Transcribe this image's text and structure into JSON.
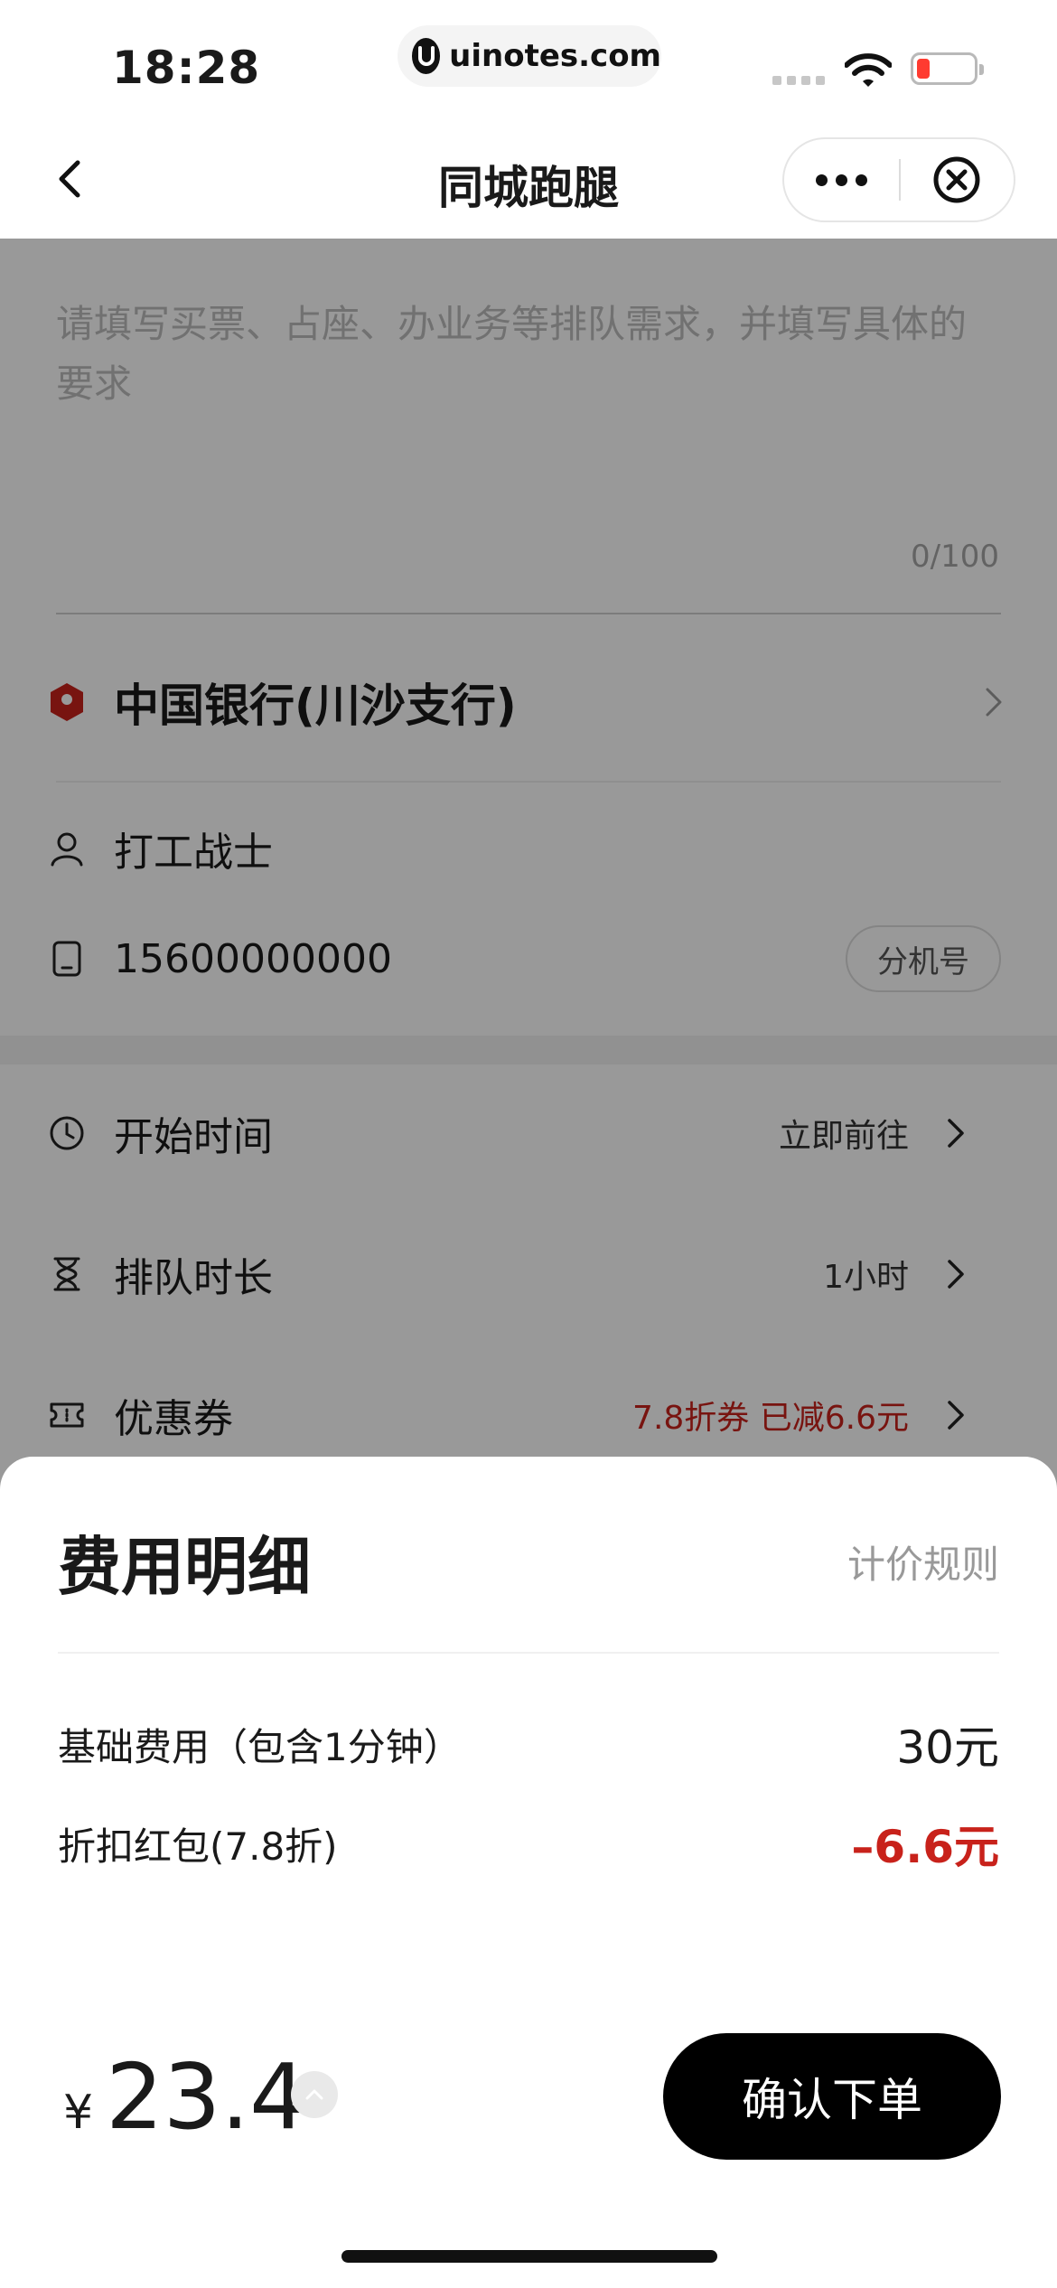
{
  "status_bar": {
    "time": "18:28",
    "url": "uinotes.com",
    "battery_color": "#ff3b30"
  },
  "nav": {
    "title": "同城跑腿",
    "icons": [
      "back-chevron-icon",
      "more-dots-icon",
      "close-circle-icon"
    ]
  },
  "form": {
    "request_placeholder": "请填写买票、占座、办业务等排队需求，并填写具体的要求",
    "request_value": "",
    "char_count": "0/100",
    "address": "中国银行(川沙支行)",
    "contact_name": "打工战士",
    "phone": "15600000000",
    "extension_label": "分机号"
  },
  "options": [
    {
      "icon": "clock-icon",
      "label": "开始时间",
      "value": "立即前往"
    },
    {
      "icon": "hourglass-icon",
      "label": "排队时长",
      "value": "1小时"
    },
    {
      "icon": "ticket-icon",
      "label": "优惠券",
      "value": "7.8折券  已减6.6元",
      "value_color": "#c8221b"
    }
  ],
  "sheet": {
    "title": "费用明细",
    "pricing_rules_label": "计价规则",
    "fees": [
      {
        "label": "基础费用（包含1分钟）",
        "value": "30元"
      },
      {
        "label": "折扣红包(7.8折)",
        "value": "–6.6元",
        "value_color": "#c8221b"
      }
    ],
    "currency": "¥",
    "total": "23.4",
    "confirm_label": "确认下单"
  },
  "colors": {
    "accent_red": "#c8221b",
    "overlay": "rgba(0,0,0,0.40)",
    "confirm_button": "#000000"
  }
}
